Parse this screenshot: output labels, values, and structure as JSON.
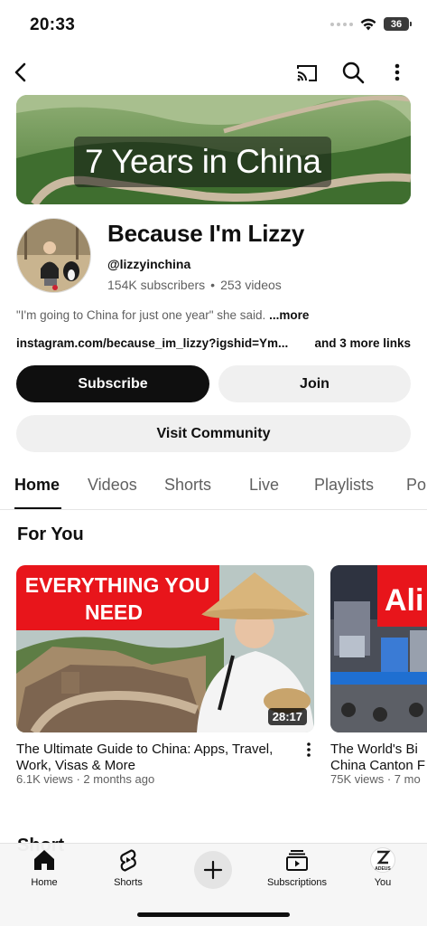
{
  "status": {
    "time": "20:33",
    "battery": "36"
  },
  "banner": {
    "text": "7 Years in China"
  },
  "channel": {
    "name": "Because I'm Lizzy",
    "handle": "@lizzyinchina",
    "subscribers": "154K subscribers",
    "videos": "253 videos",
    "description": "\"I'm going to China for just one year\" she said.",
    "more_label": "...more",
    "link": "instagram.com/because_im_lizzy?igshid=Ym...",
    "more_links": "and 3 more links"
  },
  "actions": {
    "subscribe": "Subscribe",
    "join": "Join",
    "community": "Visit Community"
  },
  "tabs": [
    "Home",
    "Videos",
    "Shorts",
    "Live",
    "Playlists",
    "Po"
  ],
  "section": {
    "title": "For You",
    "next": "Short"
  },
  "videos": [
    {
      "thumb_text": "EVERYTHING YOU NEED",
      "duration": "28:17",
      "title": "The Ultimate Guide to China: Apps, Travel, Work, Visas & More",
      "meta": "6.1K views · 2 months ago"
    },
    {
      "thumb_text": "Ali",
      "title": "The World's Bi China Canton F",
      "meta": "75K views · 7 mo"
    }
  ],
  "nav": {
    "home": "Home",
    "shorts": "Shorts",
    "subscriptions": "Subscriptions",
    "you": "You",
    "you_badge": "ADEUS"
  }
}
